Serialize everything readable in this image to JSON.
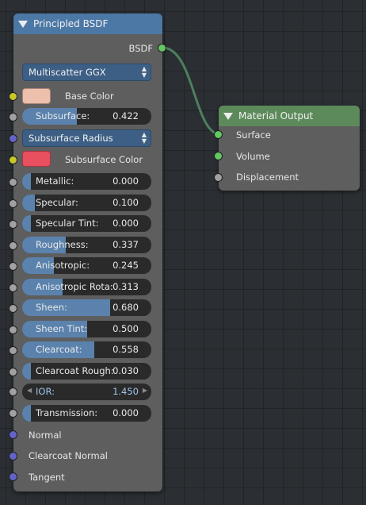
{
  "bsdf_node": {
    "title": "Principled BSDF",
    "output_socket": "BSDF",
    "distribution": "Multiscatter GGX",
    "base_color": {
      "label": "Base Color",
      "color": "#edbfad"
    },
    "subsurface": {
      "label": "Subsurface:",
      "value": "0.422",
      "fraction": 0.422
    },
    "subsurface_method": "Subsurface Radius",
    "subsurface_color": {
      "label": "Subsurface Color",
      "color": "#e84f5f"
    },
    "sliders": [
      {
        "label": "Metallic:",
        "value": "0.000",
        "fraction": 0.0
      },
      {
        "label": "Specular:",
        "value": "0.100",
        "fraction": 0.1
      },
      {
        "label": "Specular Tint:",
        "value": "0.000",
        "fraction": 0.0
      },
      {
        "label": "Roughness:",
        "value": "0.337",
        "fraction": 0.337
      },
      {
        "label": "Anisotropic:",
        "value": "0.245",
        "fraction": 0.245
      },
      {
        "label": "Anisotropic Rota:",
        "value": "0.313",
        "fraction": 0.313
      },
      {
        "label": "Sheen:",
        "value": "0.680",
        "fraction": 0.68
      },
      {
        "label": "Sheen Tint:",
        "value": "0.500",
        "fraction": 0.5
      },
      {
        "label": "Clearcoat:",
        "value": "0.558",
        "fraction": 0.558
      },
      {
        "label": "Clearcoat Rough:",
        "value": "0.030",
        "fraction": 0.03
      }
    ],
    "ior": {
      "label": "IOR:",
      "value": "1.450"
    },
    "transmission": {
      "label": "Transmission:",
      "value": "0.000",
      "fraction": 0.0
    },
    "vector_inputs": [
      "Normal",
      "Clearcoat Normal",
      "Tangent"
    ]
  },
  "output_node": {
    "title": "Material Output",
    "inputs": [
      "Surface",
      "Volume",
      "Displacement"
    ]
  },
  "colors": {
    "bsdf_header": "#4c78a6",
    "output_header": "#5d8a5b",
    "link": "#4f7f5d",
    "slider_fill": "#5a82ad"
  }
}
